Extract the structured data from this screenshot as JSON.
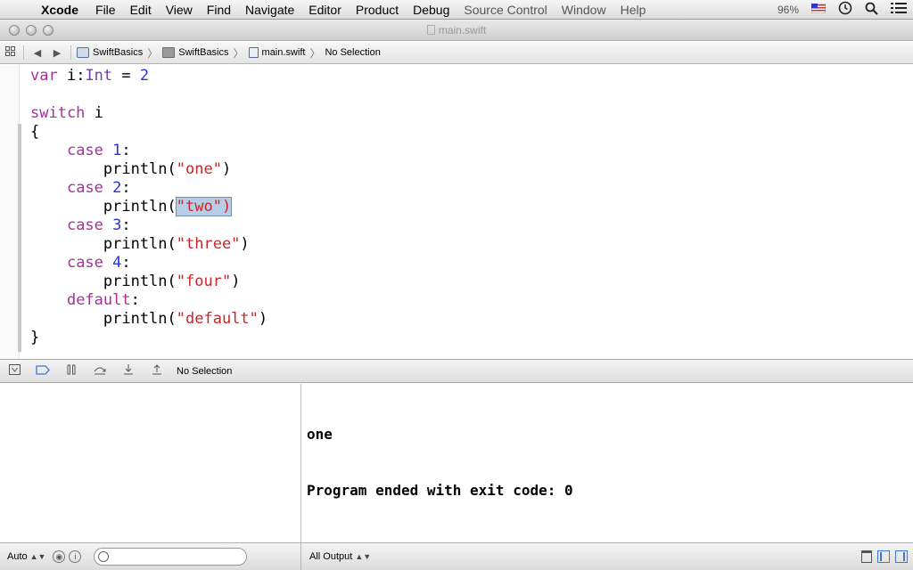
{
  "menubar": {
    "apple": "",
    "items": [
      "Xcode",
      "File",
      "Edit",
      "View",
      "Find",
      "Navigate",
      "Editor",
      "Product",
      "Debug",
      "Source Control",
      "Window",
      "Help"
    ],
    "battery": "96%"
  },
  "window": {
    "title": "main.swift"
  },
  "jumpbar": {
    "crumbs": [
      "SwiftBasics",
      "SwiftBasics",
      "main.swift",
      "No Selection"
    ]
  },
  "code": {
    "lines": [
      [
        {
          "t": "var",
          "c": "kw"
        },
        {
          "t": " i:"
        },
        {
          "t": "Int",
          "c": "typ"
        },
        {
          "t": " = "
        },
        {
          "t": "2",
          "c": "num"
        }
      ],
      [],
      [
        {
          "t": "switch",
          "c": "kw"
        },
        {
          "t": " i"
        }
      ],
      [
        {
          "t": "{"
        }
      ],
      [
        {
          "t": "    "
        },
        {
          "t": "case",
          "c": "kw"
        },
        {
          "t": " "
        },
        {
          "t": "1",
          "c": "num"
        },
        {
          "t": ":"
        }
      ],
      [
        {
          "t": "        println("
        },
        {
          "t": "\"one\"",
          "c": "str"
        },
        {
          "t": ")"
        }
      ],
      [
        {
          "t": "    "
        },
        {
          "t": "case",
          "c": "kw"
        },
        {
          "t": " "
        },
        {
          "t": "2",
          "c": "num"
        },
        {
          "t": ":"
        }
      ],
      [
        {
          "t": "        println("
        },
        {
          "t": "\"two\")",
          "c": "str sel"
        }
      ],
      [
        {
          "t": "    "
        },
        {
          "t": "case",
          "c": "kw"
        },
        {
          "t": " "
        },
        {
          "t": "3",
          "c": "num"
        },
        {
          "t": ":"
        }
      ],
      [
        {
          "t": "        println("
        },
        {
          "t": "\"three\"",
          "c": "str"
        },
        {
          "t": ")"
        }
      ],
      [
        {
          "t": "    "
        },
        {
          "t": "case",
          "c": "kw"
        },
        {
          "t": " "
        },
        {
          "t": "4",
          "c": "num"
        },
        {
          "t": ":"
        }
      ],
      [
        {
          "t": "        println("
        },
        {
          "t": "\"four\"",
          "c": "str"
        },
        {
          "t": ")"
        }
      ],
      [
        {
          "t": "    "
        },
        {
          "t": "default",
          "c": "kw"
        },
        {
          "t": ":"
        }
      ],
      [
        {
          "t": "        println("
        },
        {
          "t": "\"default\"",
          "c": "str"
        },
        {
          "t": ")"
        }
      ],
      [
        {
          "t": "}"
        }
      ]
    ]
  },
  "debugbar": {
    "selection": "No Selection"
  },
  "console": {
    "lines": [
      "one",
      "Program ended with exit code: 0"
    ]
  },
  "footer": {
    "variables_popup": "Auto",
    "output_popup": "All Output"
  },
  "colors": {
    "keyword": "#a7309a",
    "number": "#2a33d6",
    "string": "#c4282a",
    "accent": "#3a77d9"
  }
}
